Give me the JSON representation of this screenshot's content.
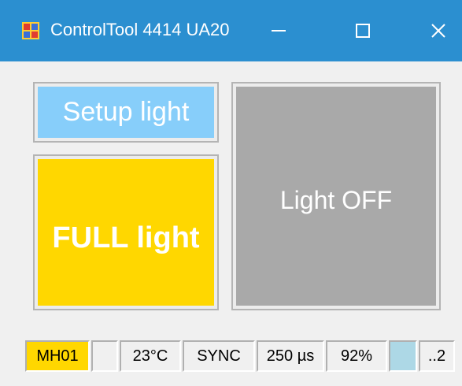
{
  "window": {
    "title": "ControlTool 4414 UA20",
    "icon": "app-window-icon",
    "controls": {
      "minimize_icon": "minimize-icon",
      "maximize_icon": "maximize-icon",
      "close_icon": "close-icon"
    },
    "titlebar_color": "#2b8fd0"
  },
  "main": {
    "setup_button": {
      "label": "Setup light",
      "color": "#87cefa"
    },
    "full_button": {
      "label": "FULL light",
      "color": "#ffd700"
    },
    "off_button": {
      "label": "Light OFF",
      "color": "#a9a9a9"
    }
  },
  "statusbar": {
    "cells": [
      {
        "text": "MH01",
        "color": "#ffd700"
      },
      {
        "text": ""
      },
      {
        "text": "23°C"
      },
      {
        "text": "SYNC"
      },
      {
        "text": "250 µs"
      },
      {
        "text": "92%"
      },
      {
        "text": "",
        "color": "#add8e6"
      },
      {
        "text": "..2"
      }
    ]
  }
}
